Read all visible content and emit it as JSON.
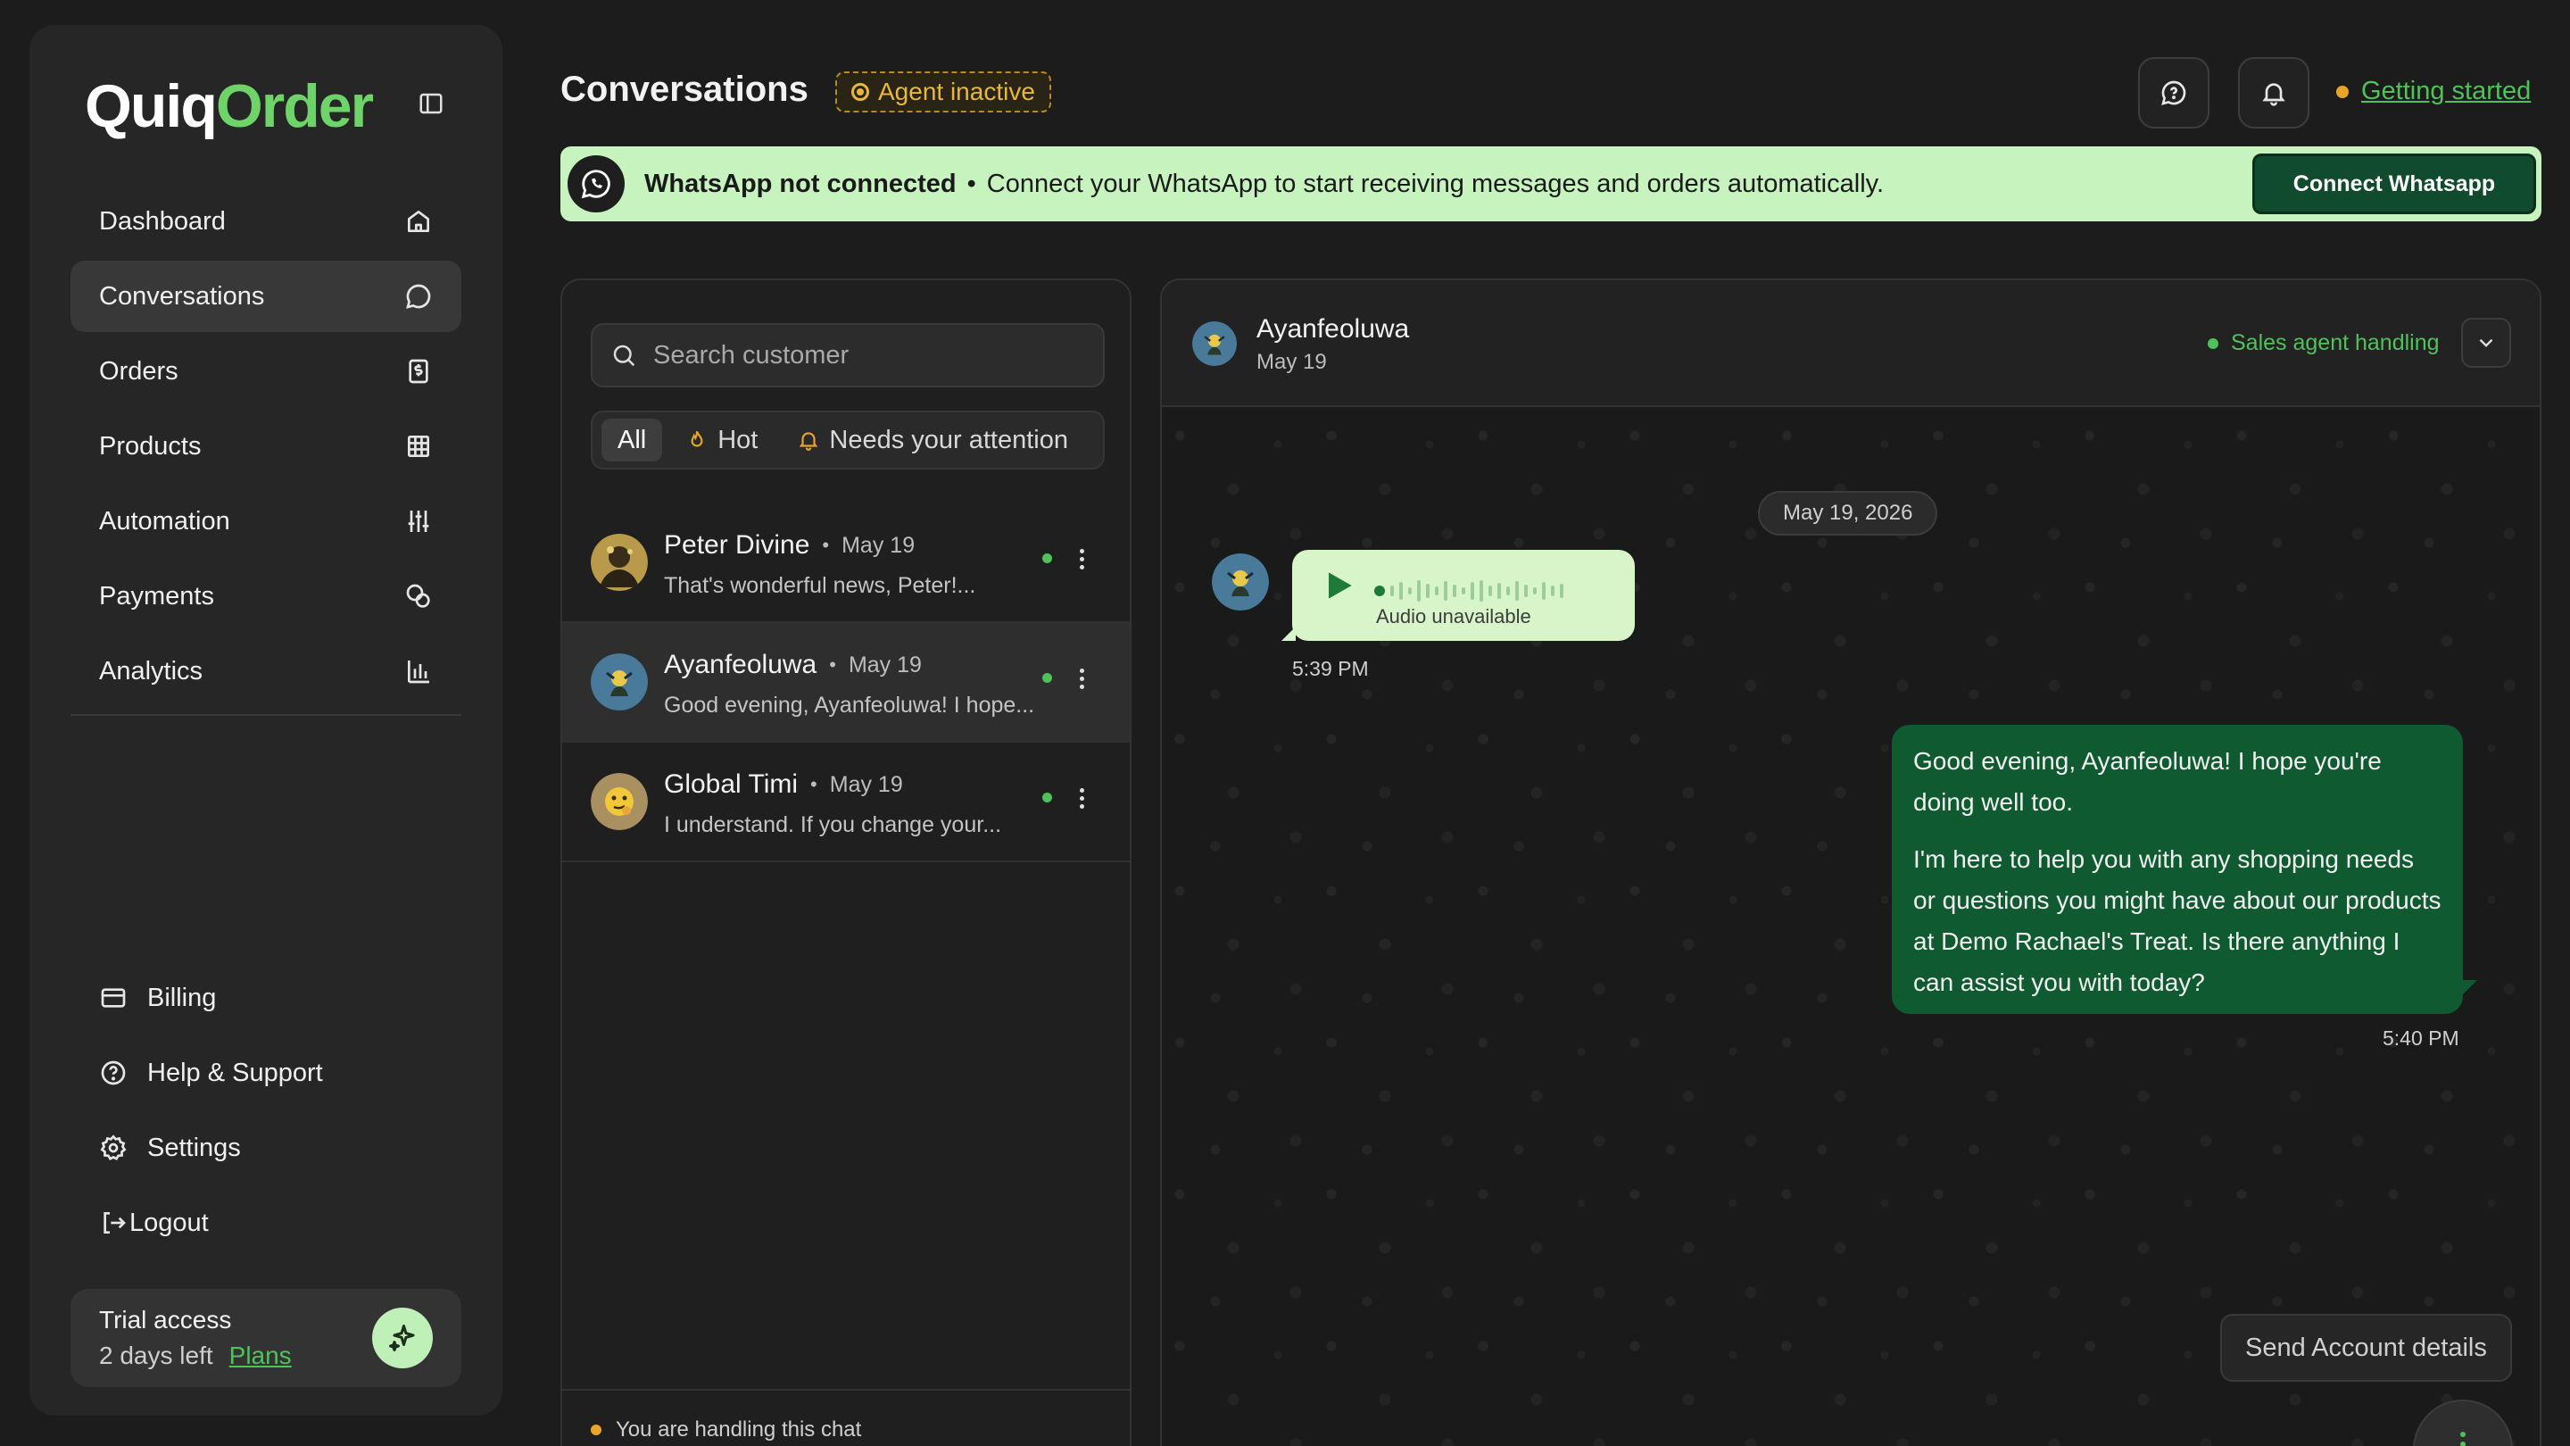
{
  "app": {
    "logo_main": "Quiq",
    "logo_accent": "Order"
  },
  "colors": {
    "accent_green": "#4fc25a",
    "banner_bg": "#c6f3be",
    "outgoing_bubble": "#0f5a31",
    "warning": "#e8b83a"
  },
  "sidebar": {
    "items": [
      {
        "label": "Dashboard",
        "icon": "home-icon"
      },
      {
        "label": "Conversations",
        "icon": "chat-bubble-icon"
      },
      {
        "label": "Orders",
        "icon": "receipt-icon"
      },
      {
        "label": "Products",
        "icon": "grid-icon"
      },
      {
        "label": "Automation",
        "icon": "sliders-icon"
      },
      {
        "label": "Payments",
        "icon": "coins-icon"
      },
      {
        "label": "Analytics",
        "icon": "bar-chart-icon"
      }
    ],
    "bottom": [
      {
        "label": "Billing",
        "icon": "card-icon"
      },
      {
        "label": "Help & Support",
        "icon": "help-circle-icon"
      },
      {
        "label": "Settings",
        "icon": "gear-icon"
      },
      {
        "label": "Logout",
        "icon": "logout-icon"
      }
    ],
    "trial": {
      "title": "Trial access",
      "days_left": "2 days left",
      "plans_link": "Plans"
    }
  },
  "header": {
    "title": "Conversations",
    "agent_status": "Agent inactive",
    "getting_started": "Getting started"
  },
  "banner": {
    "title": "WhatsApp not connected",
    "separator": "•",
    "message": "Connect your WhatsApp to start receiving messages and orders automatically.",
    "button": "Connect Whatsapp"
  },
  "list": {
    "search_placeholder": "Search customer",
    "filters": [
      "All",
      "Hot",
      "Needs your attention"
    ],
    "conversations": [
      {
        "name": "Peter Divine",
        "date": "May 19",
        "preview": "That's wonderful news, Peter!..."
      },
      {
        "name": "Ayanfeoluwa",
        "date": "May 19",
        "preview": "Good evening, Ayanfeoluwa! I hope..."
      },
      {
        "name": "Global Timi",
        "date": "May 19",
        "preview": "I understand. If you change your..."
      }
    ],
    "handling_note": "You are handling this chat"
  },
  "chat": {
    "name": "Ayanfeoluwa",
    "date": "May 19",
    "status": "Sales agent handling",
    "date_chip": "May 19, 2026",
    "audio_label": "Audio unavailable",
    "audio_time": "5:39 PM",
    "outgoing": {
      "p1": "Good evening, Ayanfeoluwa! I hope you're doing well too.",
      "p2": "I'm here to help you with any shopping needs or questions you might have about our products at Demo Rachael's Treat. Is there anything I can assist you with today?",
      "time": "5:40 PM"
    },
    "quick_reply": "Send Account details"
  }
}
